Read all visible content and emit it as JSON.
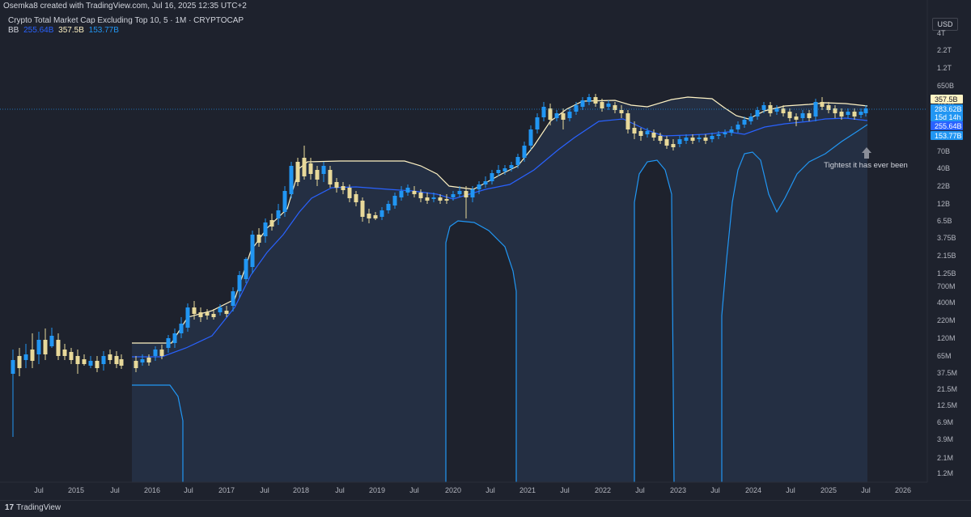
{
  "header": {
    "attribution": "Osemka8 created with TradingView.com, Jul 16, 2025 12:35 UTC+2"
  },
  "legend": {
    "title": "Crypto Total Market Cap Excluding Top 10, 5 · 1M · CRYPTOCAP",
    "bb_label": "BB",
    "bb_basis": "255.64B",
    "bb_upper": "357.5B",
    "bb_lower": "153.77B"
  },
  "currency": "USD",
  "footer": {
    "logo_mark": "17",
    "logo_text": "TradingView"
  },
  "annotation": {
    "text": "Tightest it has ever been"
  },
  "colors": {
    "background": "#1e222d",
    "candle_up": "#2196f3",
    "candle_down": "#e8d99a",
    "bb_upper": "#fff3c4",
    "bb_basis": "#2962ff",
    "bb_lower": "#2196f3",
    "bb_fill": "#2a3b55",
    "annotation_arrow": "#8a8e99"
  },
  "chart_data": {
    "type": "candlestick",
    "y_scale": "log",
    "price_labels": [
      "357.5B",
      "283.62B",
      "15d 14h",
      "255.64B",
      "153.77B"
    ],
    "y_ticks": [
      "4T",
      "2.2T",
      "1.2T",
      "650B",
      "200B",
      "130B",
      "70B",
      "40B",
      "22B",
      "12B",
      "6.5B",
      "3.75B",
      "2.15B",
      "1.25B",
      "700M",
      "400M",
      "220M",
      "120M",
      "65M",
      "37.5M",
      "21.5M",
      "12.5M",
      "6.9M",
      "3.9M",
      "2.1M",
      "1.2M"
    ],
    "x_ticks": [
      "Jul",
      "2015",
      "Jul",
      "2016",
      "Jul",
      "2017",
      "Jul",
      "2018",
      "Jul",
      "2019",
      "Jul",
      "2020",
      "Jul",
      "2021",
      "Jul",
      "2022",
      "Jul",
      "2023",
      "Jul",
      "2024",
      "Jul",
      "2025",
      "Jul",
      "2026"
    ],
    "series": [
      {
        "name": "BB",
        "values_basis_last": "255.64B",
        "values_upper_last": "357.5B",
        "values_lower_last": "153.77B"
      }
    ]
  }
}
